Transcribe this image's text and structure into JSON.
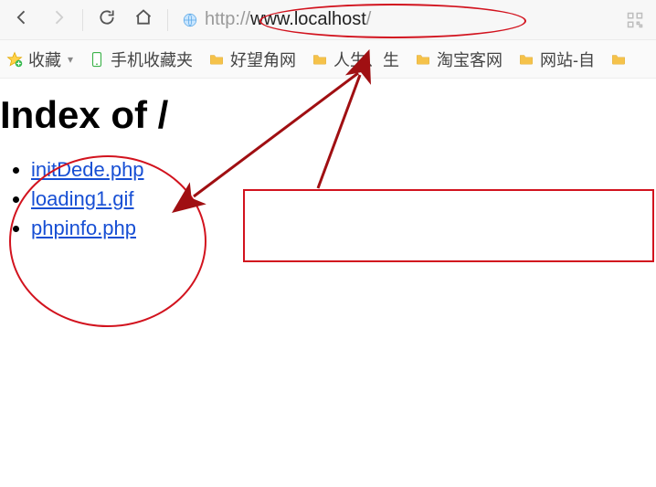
{
  "browser": {
    "url_gray_prefix": "http://",
    "url_dark": "www.localhost",
    "url_gray_suffix": "/"
  },
  "bookmarks": {
    "fav_label": "收藏",
    "items": [
      {
        "label": "手机收藏夹",
        "icon": "mobile"
      },
      {
        "label": "好望角网",
        "icon": "folder"
      },
      {
        "label": "人生、生",
        "icon": "folder"
      },
      {
        "label": "淘宝客网",
        "icon": "folder"
      },
      {
        "label": "网站-自",
        "icon": "folder"
      }
    ]
  },
  "page": {
    "heading": "Index of /",
    "files": [
      "initDede.php",
      "loading1.gif",
      "phpinfo.php"
    ]
  },
  "annotation_colors": {
    "red": "#d2131e"
  }
}
